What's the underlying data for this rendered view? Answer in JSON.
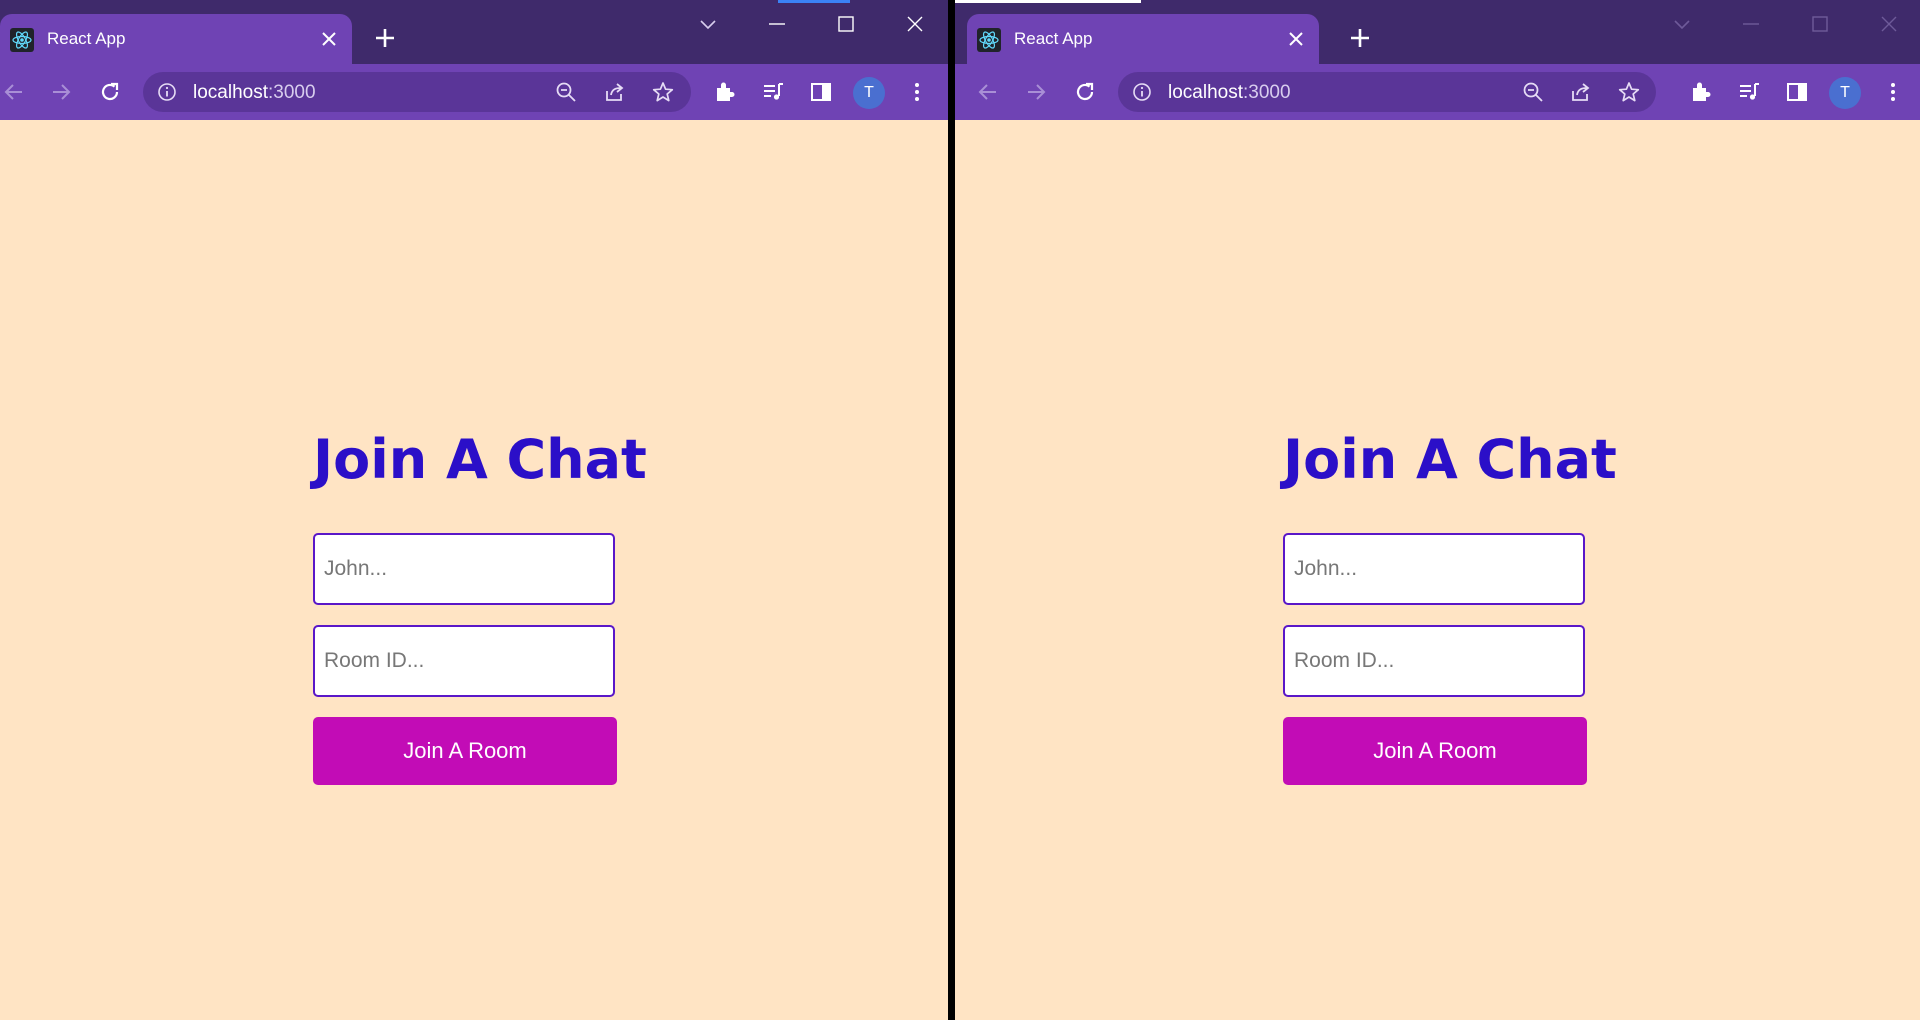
{
  "windows": [
    {
      "tab": {
        "title": "React App"
      },
      "omnibox": {
        "host": "localhost",
        "port": ":3000"
      },
      "avatar_letter": "T",
      "content": {
        "heading": "Join A Chat",
        "name_placeholder": "John...",
        "room_placeholder": "Room ID...",
        "join_button_label": "Join A Room"
      }
    },
    {
      "tab": {
        "title": "React App"
      },
      "omnibox": {
        "host": "localhost",
        "port": ":3000"
      },
      "avatar_letter": "T",
      "content": {
        "heading": "Join A Chat",
        "name_placeholder": "John...",
        "room_placeholder": "Room ID...",
        "join_button_label": "Join A Room"
      }
    }
  ],
  "colors": {
    "chrome_titlebar": "#3f2a6b",
    "chrome_toolbar": "#6f43b4",
    "page_background": "#ffe4c4",
    "heading": "#2b0fc8",
    "input_border": "#5a17c8",
    "button": "#c20cb6"
  },
  "icons": [
    "react-favicon-icon",
    "close-icon",
    "plus-icon",
    "chevron-down-icon",
    "minimize-icon",
    "maximize-icon",
    "back-arrow-icon",
    "forward-arrow-icon",
    "reload-icon",
    "info-icon",
    "zoom-out-icon",
    "share-icon",
    "star-icon",
    "extensions-puzzle-icon",
    "media-queue-icon",
    "side-panel-icon",
    "kebab-menu-icon"
  ]
}
